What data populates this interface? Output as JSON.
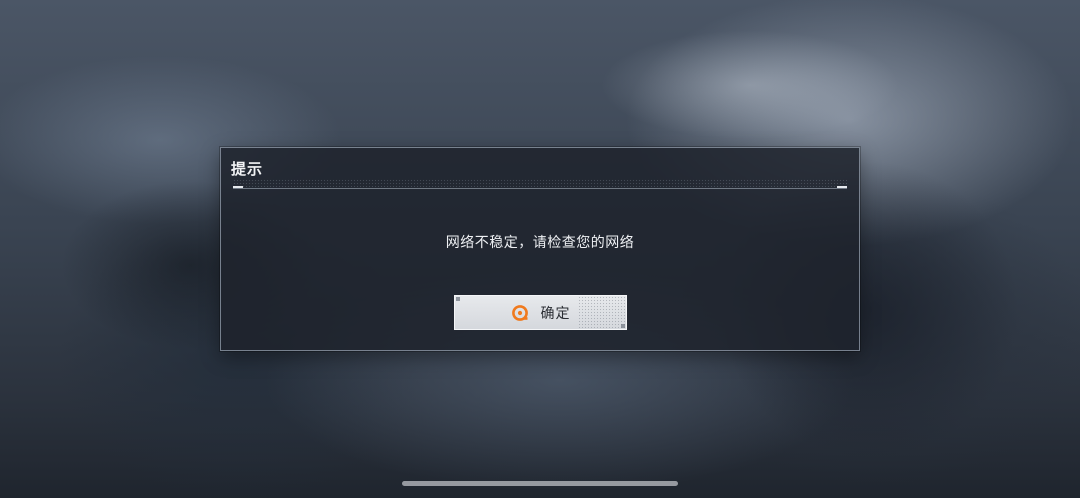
{
  "dialog": {
    "title": "提示",
    "message": "网络不稳定，请检查您的网络",
    "confirm_label": "确定",
    "confirm_icon": "circle-confirm-icon"
  },
  "colors": {
    "accent": "#f07a1e",
    "dialog_bg": "#1e232c",
    "button_bg": "#e1e3e7",
    "text_light": "#f2f3f5",
    "text_dark": "#2a2d33"
  }
}
